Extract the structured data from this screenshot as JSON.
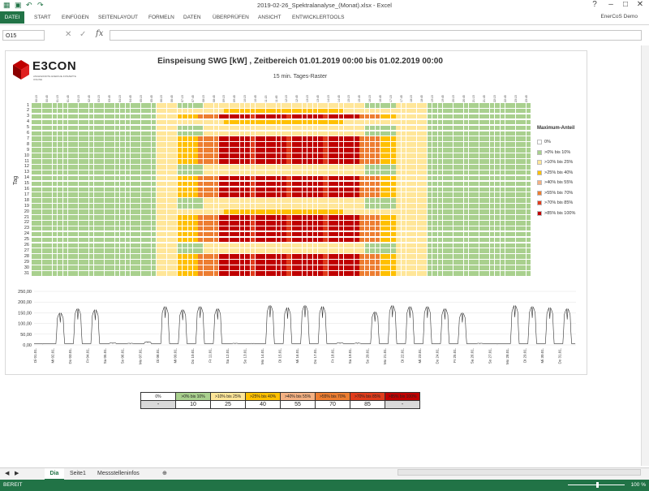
{
  "window": {
    "title": "2019-02-26_Spektralanalyse_(Monat).xlsx - Excel",
    "controls": [
      "?",
      "–",
      "□",
      "✕"
    ]
  },
  "ribbon": {
    "tabs": [
      "DATEI",
      "START",
      "EINFÜGEN",
      "SEITENLAYOUT",
      "FORMELN",
      "DATEN",
      "ÜBERPRÜFEN",
      "ANSICHT",
      "ENTWICKLERTOOLS"
    ],
    "user": "EnerCoS Demo"
  },
  "formula_bar": {
    "name_box": "O15",
    "fx": "fx",
    "value": ""
  },
  "logo": {
    "text": "E3CON",
    "sub": "ANGEWANDTE ENERGIE-KONZEPTE ONLINE"
  },
  "chart_data": [
    {
      "type": "heatmap",
      "title": "Einspeisung SWG [kW] , Zeitbereich 01.01.2019 00:00 bis 01.02.2019 00:00",
      "subtitle": "15 min. Tages-Raster",
      "ylabel": "Tag",
      "rows": [
        "1",
        "2",
        "3",
        "4",
        "5",
        "6",
        "7",
        "8",
        "9",
        "10",
        "11",
        "12",
        "13",
        "14",
        "15",
        "16",
        "17",
        "18",
        "19",
        "20",
        "21",
        "22",
        "23",
        "24",
        "25",
        "26",
        "27",
        "28",
        "29",
        "30",
        "31"
      ],
      "columns_per_day": 96,
      "x_tick_labels": [
        "00:15",
        "00:45",
        "01:15",
        "01:45",
        "02:15",
        "02:45",
        "03:15",
        "03:45",
        "04:15",
        "04:45",
        "05:15",
        "05:45",
        "06:15",
        "06:45",
        "07:15",
        "07:45",
        "08:15",
        "08:45",
        "09:15",
        "09:45",
        "10:15",
        "10:45",
        "11:15",
        "11:45",
        "12:15",
        "12:45",
        "13:15",
        "13:45",
        "14:15",
        "14:45",
        "15:15",
        "15:45",
        "16:15",
        "16:45",
        "17:15",
        "17:45",
        "18:15",
        "18:45",
        "19:15",
        "19:45",
        "20:15",
        "20:45",
        "21:15",
        "21:45",
        "22:15",
        "22:45",
        "23:15",
        "23:45"
      ],
      "legend_title": "Maximum-Anteil",
      "legend": [
        {
          "label": "0%",
          "color": "#ffffff"
        },
        {
          "label": ">0% bis 10%",
          "color": "#a9d08e"
        },
        {
          "label": ">10% bis 25%",
          "color": "#ffe699"
        },
        {
          "label": ">25% bis 40%",
          "color": "#ffc000"
        },
        {
          "label": ">40% bis 55%",
          "color": "#f4b183"
        },
        {
          "label": ">55% bis 70%",
          "color": "#ed7d31"
        },
        {
          "label": ">70% bis 85%",
          "color": "#e03c1c"
        },
        {
          "label": ">85% bis 100%",
          "color": "#c00000"
        }
      ],
      "day_class": [
        "low",
        "mid",
        "high",
        "mid",
        "low",
        "low",
        "high",
        "high",
        "high",
        "high",
        "high",
        "low",
        "low",
        "high",
        "high",
        "high",
        "high",
        "low",
        "low",
        "mid",
        "high",
        "high",
        "high",
        "high",
        "high",
        "low",
        "low",
        "high",
        "high",
        "high",
        "high"
      ]
    },
    {
      "type": "line",
      "yticks": [
        "250,00",
        "200,00",
        "150,00",
        "100,00",
        "50,00",
        "0,00"
      ],
      "ylim": [
        0,
        250
      ],
      "x_tick_labels": [
        "Di 01.01.",
        "Mi 02.01.",
        "Do 03.01.",
        "Fr 04.01.",
        "Sa 05.01.",
        "So 06.01.",
        "Mo 07.01.",
        "Di 08.01.",
        "Mi 09.01.",
        "Do 10.01.",
        "Fr 11.01.",
        "Sa 12.01.",
        "So 13.01.",
        "Mo 14.01.",
        "Di 15.01.",
        "Mi 16.01.",
        "Do 17.01.",
        "Fr 18.01.",
        "Sa 19.01.",
        "So 20.01.",
        "Mo 21.01.",
        "Di 22.01.",
        "Mi 23.01.",
        "Do 24.01.",
        "Fr 25.01.",
        "Sa 26.01.",
        "So 27.01.",
        "Mo 28.01.",
        "Di 29.01.",
        "Mi 30.01.",
        "Do 31.01."
      ],
      "daily_peak": [
        5,
        150,
        170,
        165,
        10,
        8,
        15,
        180,
        165,
        180,
        170,
        8,
        7,
        185,
        175,
        185,
        180,
        10,
        9,
        155,
        185,
        180,
        180,
        170,
        150,
        8,
        6,
        185,
        180,
        175,
        170
      ]
    }
  ],
  "scale_table": {
    "header": [
      "0%",
      ">0% bis 10%",
      ">10% bis 25%",
      ">25% bis 40%",
      ">40% bis 55%",
      ">55% bis 70%",
      ">70% bis 85%",
      ">85% bis 100%"
    ],
    "values": [
      "-",
      "10",
      "25",
      "40",
      "55",
      "70",
      "85",
      "-"
    ],
    "colors": [
      "#ffffff",
      "#a9d08e",
      "#ffe699",
      "#ffc000",
      "#f4b183",
      "#ed7d31",
      "#e03c1c",
      "#c00000"
    ]
  },
  "sheet_tabs": [
    "Dia",
    "Seite1",
    "Messstelleninfos"
  ],
  "status": {
    "text": "BEREIT",
    "zoom": "100 %"
  }
}
